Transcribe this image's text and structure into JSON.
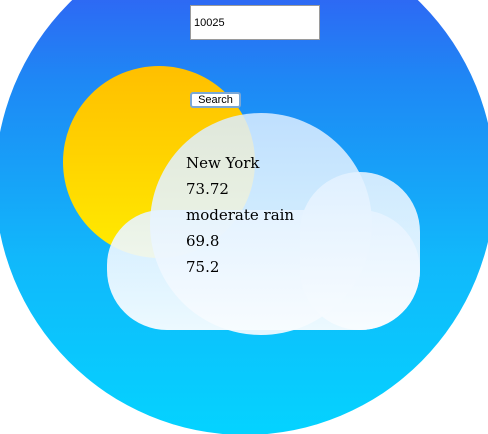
{
  "search": {
    "zip_value": "10025",
    "button_label": "Search"
  },
  "weather": {
    "city": "New York",
    "temperature": "73.72",
    "description": "moderate rain",
    "temp_min": "69.8",
    "temp_max": "75.2"
  },
  "icons": {
    "sun": "sun-icon",
    "cloud": "cloud-icon"
  },
  "colors": {
    "sky_top": "#3a4ff2",
    "sky_bottom": "#04d3ff",
    "sun_top": "#ffbf00",
    "sun_bottom": "#ffec00",
    "cloud": "#f4faff"
  }
}
